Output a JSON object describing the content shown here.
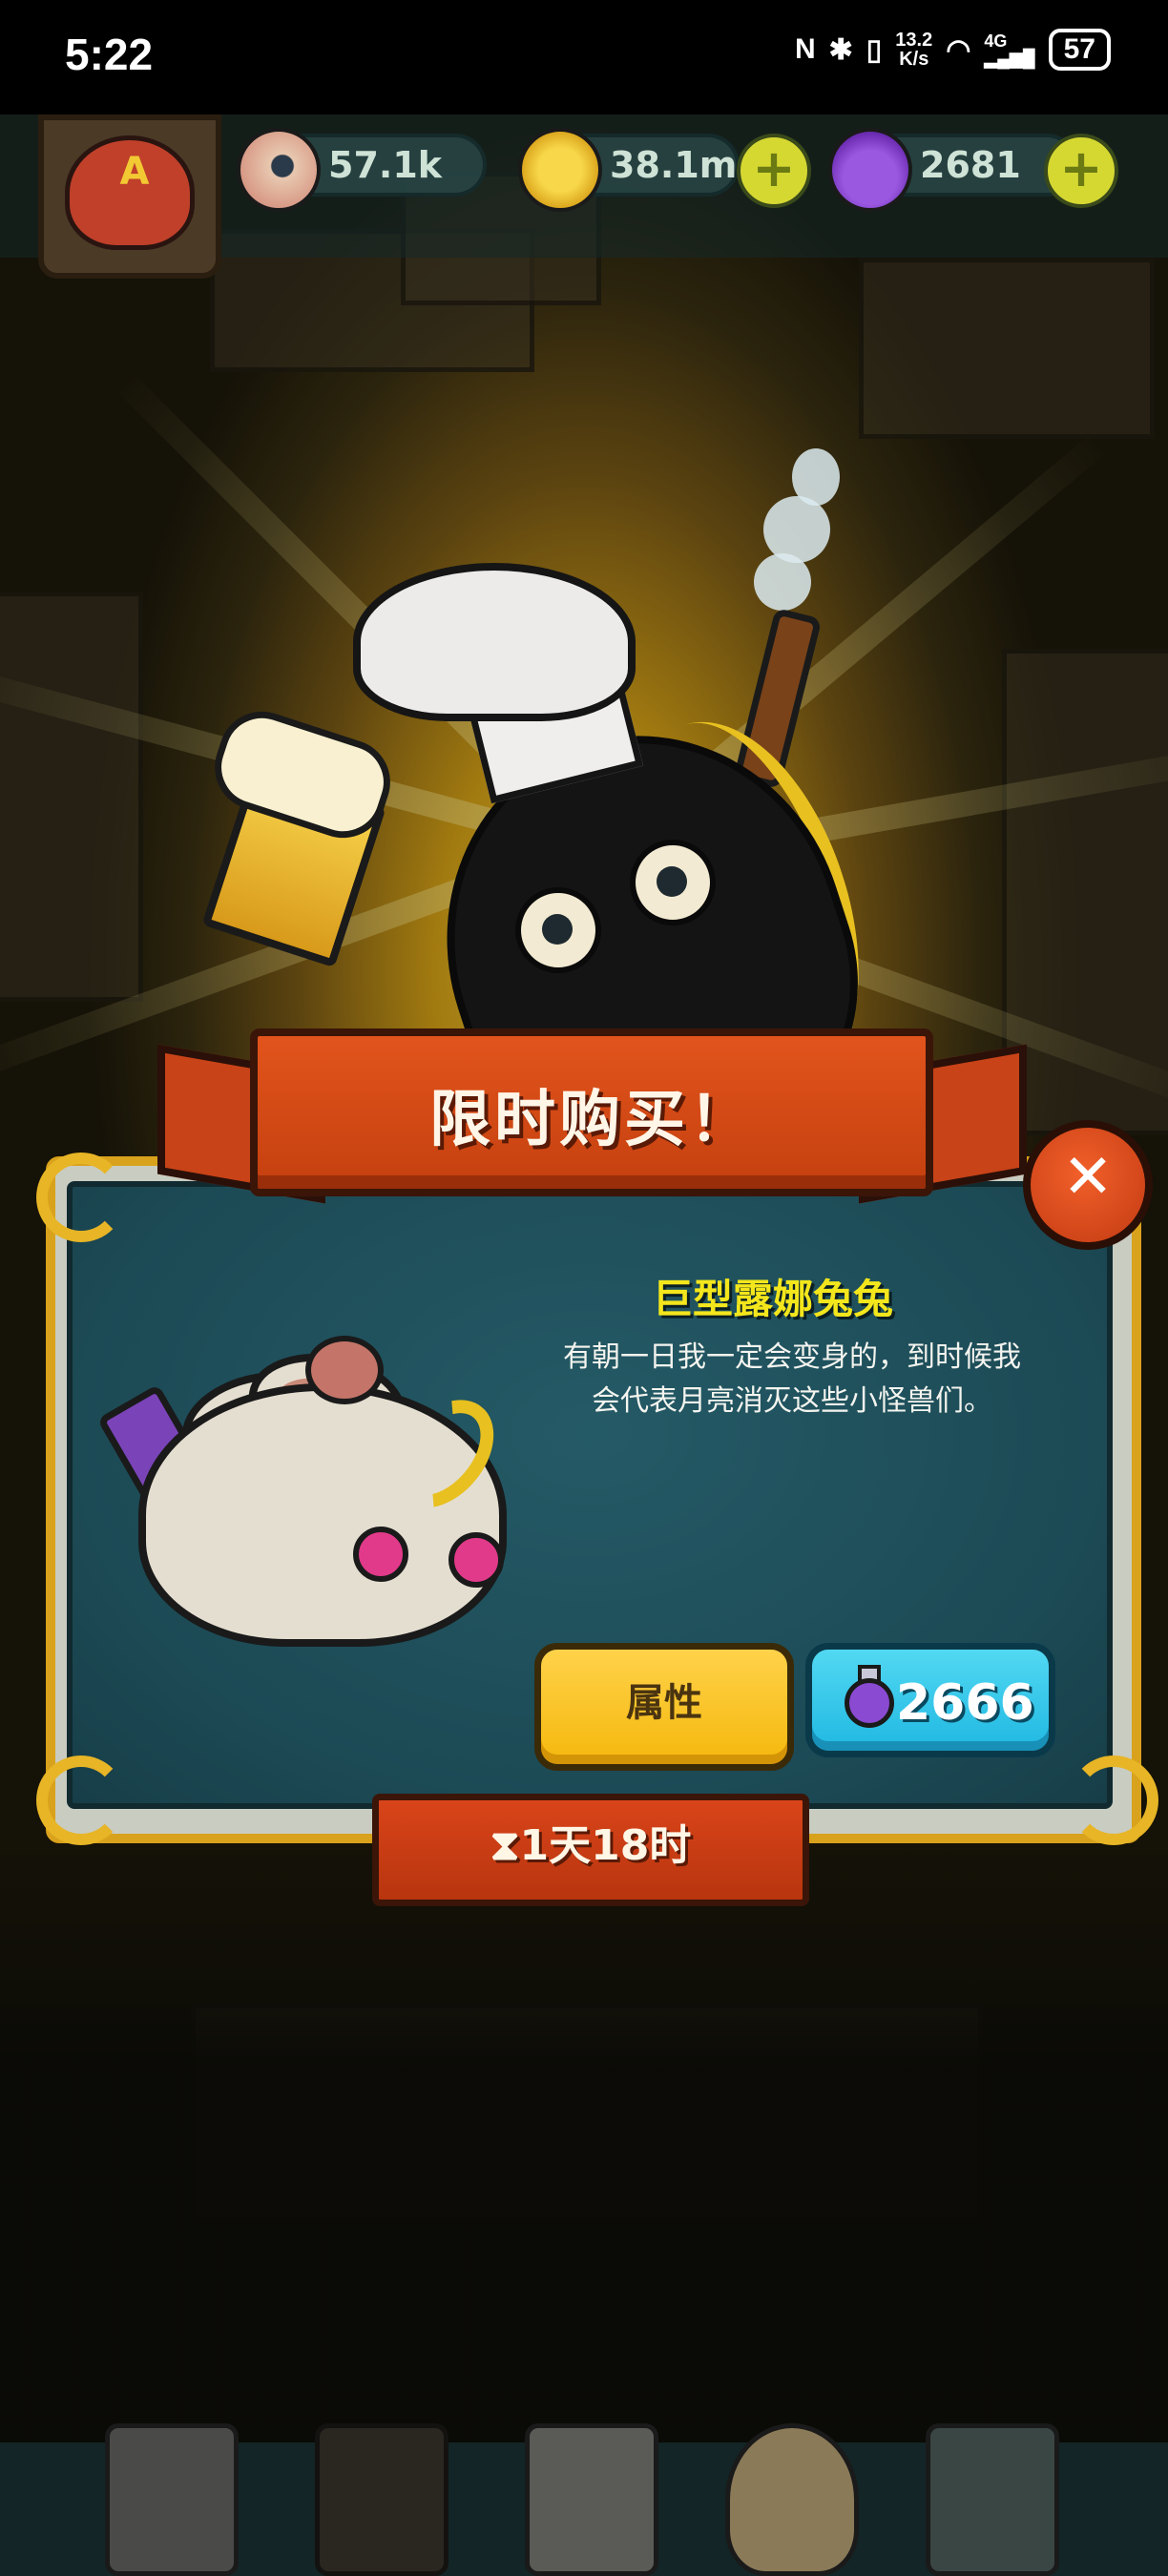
{
  "status_bar": {
    "time": "5:22",
    "speed_value": "13.2",
    "speed_unit": "K/s",
    "network": "4G",
    "battery": "57"
  },
  "resources": [
    {
      "icon": "eyeball-icon",
      "value": "57.1k",
      "has_plus": false
    },
    {
      "icon": "gold-coin-icon",
      "value": "38.1m",
      "has_plus": true
    },
    {
      "icon": "potion-icon",
      "value": "2681",
      "has_plus": true
    }
  ],
  "player_badge": {
    "letter": "A"
  },
  "offer": {
    "title": "限时购买！",
    "item_name": "巨型露娜兔兔",
    "description_line1": "有朝一日我一定会变身的，到时候我",
    "description_line2": "会代表月亮消灭这些小怪兽们。",
    "attribute_button": "属性",
    "price": "2666",
    "price_icon": "potion-icon",
    "timer": "1天18时",
    "timer_icon": "hourglass-icon"
  },
  "colors": {
    "banner": "#d9441a",
    "panel": "#1f4e58",
    "item_name": "#f3e61c",
    "attr_button": "#f5b80c",
    "buy_button": "#20b8e2"
  },
  "bottom_nav": [
    {
      "icon": "building-icon"
    },
    {
      "icon": "monster-icon"
    },
    {
      "icon": "book-icon"
    },
    {
      "icon": "money-bag-icon"
    },
    {
      "icon": "grid-menu-icon"
    }
  ]
}
